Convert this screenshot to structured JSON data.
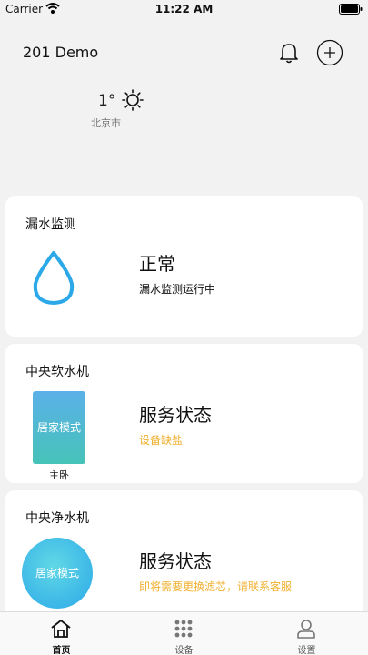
{
  "status_bar": {
    "carrier": "Carrier",
    "time": "11:22 AM"
  },
  "header": {
    "title": "201 Demo"
  },
  "weather": {
    "temperature": "1°",
    "city": "北京市"
  },
  "leak_card": {
    "title": "漏水监测",
    "status": "正常",
    "detail": "漏水监测运行中",
    "detail_color": "#111111"
  },
  "softener_card": {
    "title": "中央软水机",
    "mode": "居家模式",
    "room": "主卧",
    "status": "服务状态",
    "detail": "设备缺盐",
    "detail_color": "#f0b030"
  },
  "purifier_card": {
    "title": "中央净水机",
    "mode": "居家模式",
    "status": "服务状态",
    "detail": "即将需要更换滤芯，请联系客服",
    "detail_color": "#f0b030"
  },
  "tabs": [
    {
      "label": "首页",
      "icon": "home-icon",
      "active": true
    },
    {
      "label": "设备",
      "icon": "grid-icon",
      "active": false
    },
    {
      "label": "设置",
      "icon": "user-icon",
      "active": false
    }
  ],
  "colors": {
    "active_tab": "#111111",
    "inactive_tab": "#777777",
    "accent": "#2ba8e8"
  }
}
